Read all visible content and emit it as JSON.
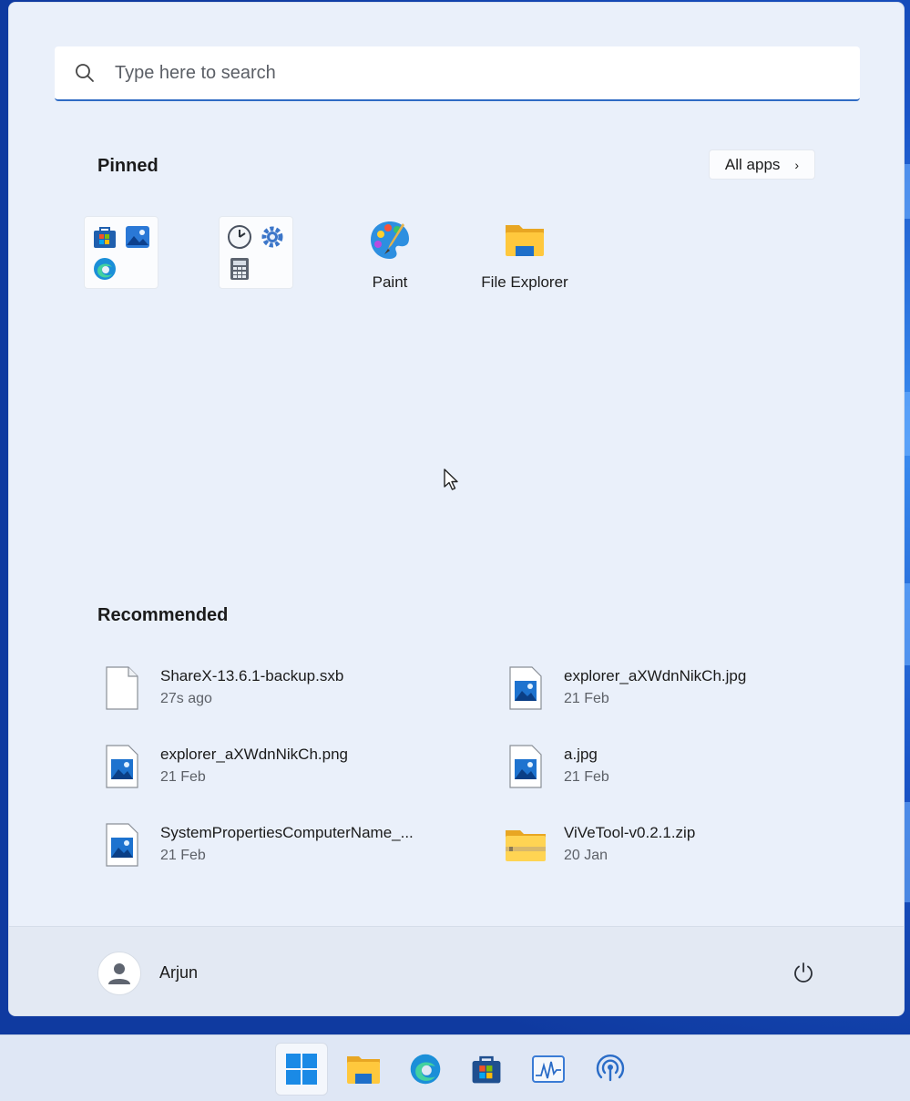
{
  "search": {
    "placeholder": "Type here to search"
  },
  "pinned": {
    "title": "Pinned",
    "all_apps_label": "All apps",
    "apps": [
      {
        "label": "Paint",
        "icon": "paint-icon"
      },
      {
        "label": "File Explorer",
        "icon": "folder-icon"
      }
    ],
    "folders": [
      {
        "icons": [
          "store-icon",
          "photos-icon",
          "edge-icon"
        ]
      },
      {
        "icons": [
          "clock-icon",
          "settings-icon",
          "calculator-icon"
        ]
      }
    ]
  },
  "recommended": {
    "title": "Recommended",
    "items": [
      {
        "name": "ShareX-13.6.1-backup.sxb",
        "when": "27s ago",
        "icon": "blank-file-icon"
      },
      {
        "name": "explorer_aXWdnNikCh.jpg",
        "when": "21 Feb",
        "icon": "image-file-icon"
      },
      {
        "name": "explorer_aXWdnNikCh.png",
        "when": "21 Feb",
        "icon": "image-file-icon"
      },
      {
        "name": "a.jpg",
        "when": "21 Feb",
        "icon": "image-file-icon"
      },
      {
        "name": "SystemPropertiesComputerName_...",
        "when": "21 Feb",
        "icon": "image-file-icon"
      },
      {
        "name": "ViVeTool-v0.2.1.zip",
        "when": "20 Jan",
        "icon": "zip-folder-icon"
      }
    ]
  },
  "user": {
    "name": "Arjun"
  },
  "taskbar": {
    "items": [
      "start-icon",
      "file-explorer-icon",
      "edge-icon",
      "store-icon",
      "activity-monitor-icon",
      "podcast-icon"
    ]
  },
  "colors": {
    "accent": "#2f6bc4",
    "panel": "#eaf0fa",
    "taskbar": "#dfe7f5"
  }
}
